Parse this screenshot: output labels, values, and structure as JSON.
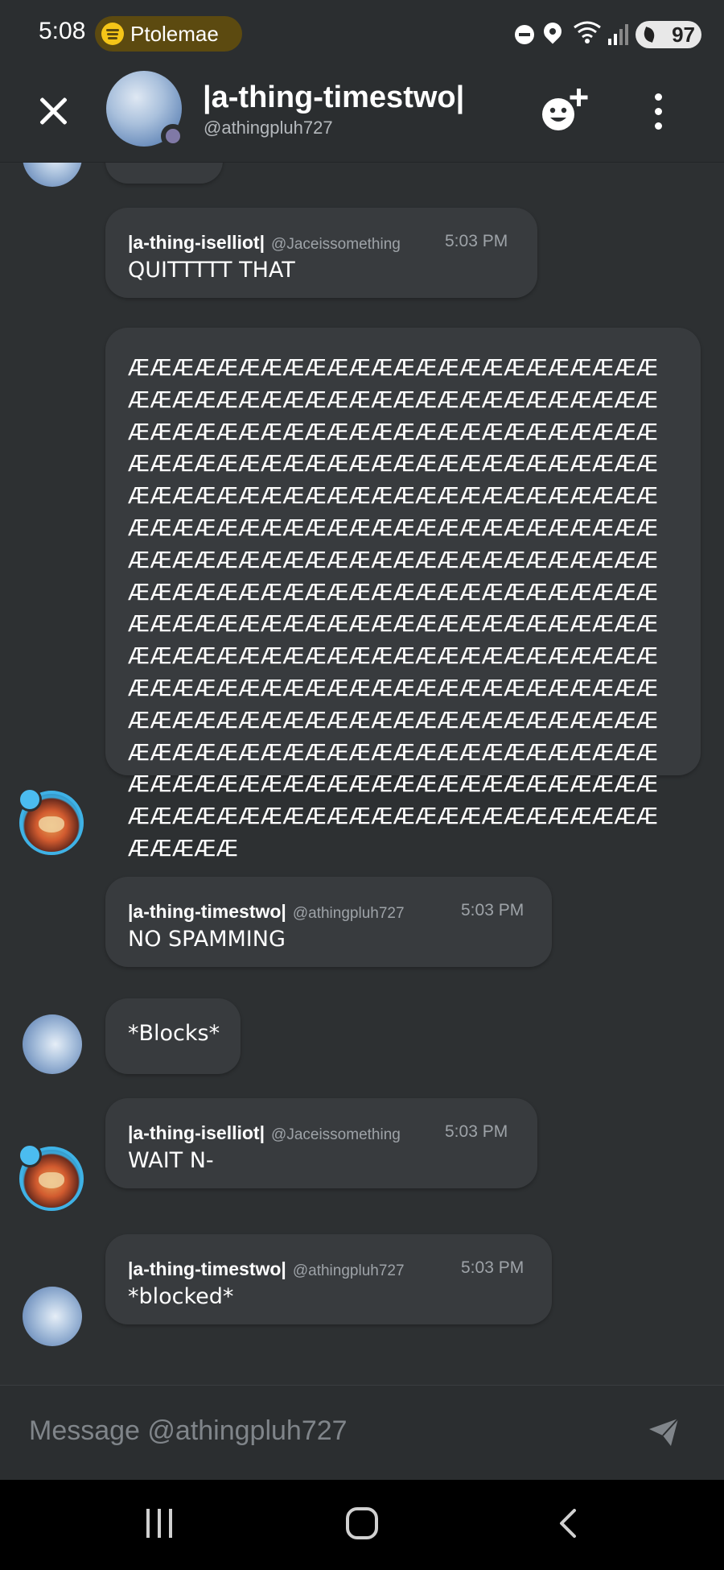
{
  "status_bar": {
    "time": "5:08",
    "now_playing": "Ptolemae",
    "battery": "97"
  },
  "header": {
    "title": "|a-thing-timestwo|",
    "handle": "@athingpluh727"
  },
  "messages": [
    {
      "author": "|a-thing-iselliot|",
      "handle": "@Jaceissomething",
      "time": "5:03 PM",
      "text": "QUITTTTT THAT"
    },
    {
      "text": "ÆÆÆÆÆÆÆÆÆÆÆÆÆÆÆÆÆÆÆÆÆÆÆÆÆÆÆÆÆÆÆÆÆÆÆÆÆÆÆÆÆÆÆÆÆÆÆÆÆÆÆÆÆÆÆÆÆÆÆÆÆÆÆÆÆÆÆÆÆÆÆÆÆÆÆÆÆÆÆÆÆÆÆÆÆÆÆÆÆÆÆÆÆÆÆÆÆÆÆÆÆÆÆÆÆÆÆÆÆÆÆÆÆÆÆÆÆÆÆÆÆÆÆÆÆÆÆÆÆÆÆÆÆÆÆÆÆÆÆÆÆÆÆÆÆÆÆÆÆÆÆÆÆÆÆÆÆÆÆÆÆÆÆÆÆÆÆÆÆÆÆÆÆÆÆÆÆÆÆÆÆÆÆÆÆÆÆÆÆÆÆÆÆÆÆÆÆÆÆÆÆÆÆÆÆÆÆÆÆÆÆÆÆÆÆÆÆÆÆÆÆÆÆÆÆÆÆÆÆÆÆÆÆÆÆÆÆÆÆÆÆÆÆÆÆÆÆÆÆÆÆÆÆÆÆÆÆÆÆÆÆÆÆÆÆÆÆÆÆÆÆÆÆÆÆÆÆÆÆÆÆÆÆÆÆÆÆÆÆÆÆÆÆÆÆÆÆÆÆÆÆÆÆÆÆÆÆÆÆÆÆÆÆÆÆÆÆÆÆÆÆÆÆÆÆÆÆÆÆÆÆÆÆÆÆÆÆÆÆÆÆÆÆÆÆÆÆÆÆÆÆÆÆÆÆÆÆÆÆÆÆÆÆÆÆ"
    },
    {
      "author": "|a-thing-timestwo|",
      "handle": "@athingpluh727",
      "time": "5:03 PM",
      "text": "NO SPAMMING"
    },
    {
      "text": "*Blocks*"
    },
    {
      "author": "|a-thing-iselliot|",
      "handle": "@Jaceissomething",
      "time": "5:03 PM",
      "text": "WAIT N-"
    },
    {
      "author": "|a-thing-timestwo|",
      "handle": "@athingpluh727",
      "time": "5:03 PM",
      "text": "*blocked*"
    }
  ],
  "composer": {
    "placeholder": "Message @athingpluh727",
    "value": ""
  },
  "icons": {
    "close": "close-icon",
    "add_friend": "add-friend-icon",
    "more": "more-vertical-icon",
    "send": "send-icon",
    "nav_recents": "recents-icon",
    "nav_home": "home-icon",
    "nav_back": "back-icon"
  },
  "colors": {
    "background": "#2d3032",
    "bubble": "#383b3e",
    "header": "#2b2e30",
    "presence": "#8079a6",
    "muted_text": "#9ea3a8",
    "pill": "#5c4a10",
    "spotify": "#f5c518"
  }
}
